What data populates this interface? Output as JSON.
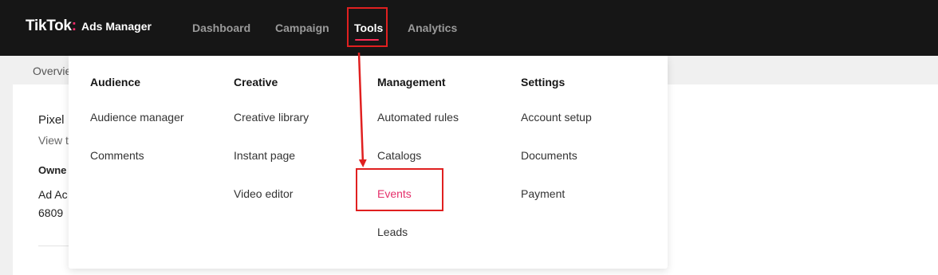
{
  "brand": {
    "logo_main": "TikTok",
    "logo_colon": ":",
    "logo_sub": "Ads Manager"
  },
  "nav": {
    "dashboard": "Dashboard",
    "campaign": "Campaign",
    "tools": "Tools",
    "analytics": "Analytics",
    "active": "Tools"
  },
  "subnav": {
    "overview": "Overvie"
  },
  "background": {
    "pixel_title": "Pixel",
    "view_text": "View t",
    "owner_label": "Owne",
    "ad_account": "Ad Ac",
    "account_id": "6809"
  },
  "tools_menu": {
    "audience": {
      "heading": "Audience",
      "items": [
        "Audience manager",
        "Comments"
      ]
    },
    "creative": {
      "heading": "Creative",
      "items": [
        "Creative library",
        "Instant page",
        "Video editor"
      ]
    },
    "management": {
      "heading": "Management",
      "items": [
        "Automated rules",
        "Catalogs",
        "Events",
        "Leads"
      ]
    },
    "settings": {
      "heading": "Settings",
      "items": [
        "Account setup",
        "Documents",
        "Payment"
      ]
    }
  },
  "colors": {
    "topbar_bg": "#161616",
    "accent": "#fe2c55",
    "highlight_text": "#e5306b",
    "annotation_red": "#e02020"
  }
}
